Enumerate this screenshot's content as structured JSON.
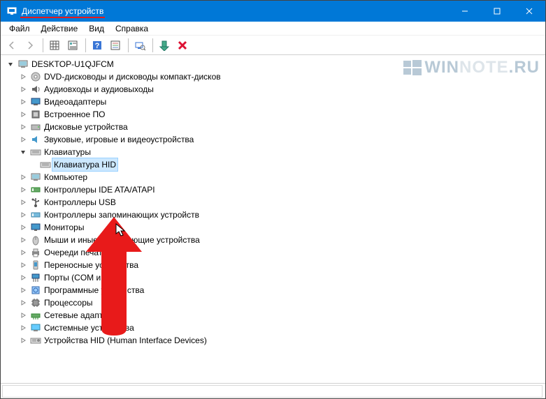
{
  "window": {
    "title": "Диспетчер устройств"
  },
  "menu": {
    "file": "Файл",
    "action": "Действие",
    "view": "Вид",
    "help": "Справка"
  },
  "tree": {
    "root": "DESKTOP-U1QJFCM",
    "items": [
      "DVD-дисководы и дисководы компакт-дисков",
      "Аудиовходы и аудиовыходы",
      "Видеоадаптеры",
      "Встроенное ПО",
      "Дисковые устройства",
      "Звуковые, игровые и видеоустройства",
      "Клавиатуры",
      "Компьютер",
      "Контроллеры IDE ATA/ATAPI",
      "Контроллеры USB",
      "Контроллеры запоминающих устройств",
      "Мониторы",
      "Мыши и иные указывающие устройства",
      "Очереди печати",
      "Переносные устройства",
      "Порты (COM и LPT)",
      "Программные устройства",
      "Процессоры",
      "Сетевые адаптеры",
      "Системные устройства",
      "Устройства HID (Human Interface Devices)"
    ],
    "selected_child": "Клавиатура HID"
  },
  "watermark": {
    "t1": "WIN",
    "t2": "NOTE",
    "t3": ".RU"
  }
}
